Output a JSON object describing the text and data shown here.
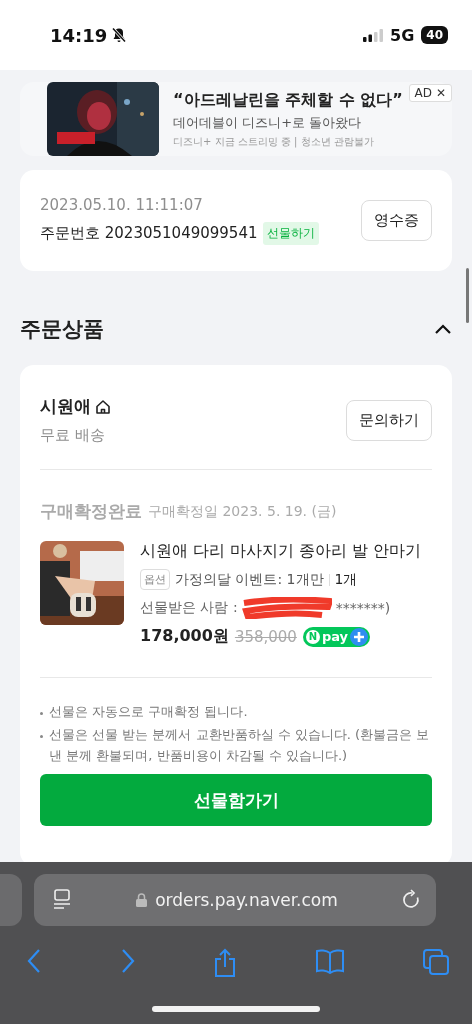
{
  "status_bar": {
    "time": "14:19",
    "network": "5G",
    "battery": "40"
  },
  "ad": {
    "headline": "“아드레날린을 주체할 수 없다”",
    "subline": "데어데블이 디즈니+로 돌아왔다",
    "note": "디즈니+ 지금 스트리밍 중 | 청소년 관람불가",
    "ad_label": "AD",
    "close": "✕"
  },
  "order": {
    "datetime": "2023.05.10. 11:11:07",
    "number_label": "주문번호",
    "number": "2023051049099541",
    "tag": "선물하기",
    "receipt_button": "영수증"
  },
  "section": {
    "title": "주문상품",
    "expanded": true
  },
  "seller": {
    "name": "시원애",
    "shipping": "무료 배송",
    "inquiry_button": "문의하기"
  },
  "item": {
    "status": "구매확정완료",
    "confirm_date": "구매확정일 2023. 5. 19. (금)",
    "title": "시원애 다리 마사지기 종아리 발 안마기",
    "option_tag": "옵션",
    "option": "가정의달 이벤트: 1개만",
    "quantity": "1개",
    "recipient_label": "선물받은 사람 :",
    "recipient_masked_tail": "*******)",
    "price": "178,000원",
    "original_price": "358,000",
    "pay_mark": "N",
    "pay_text": "pay"
  },
  "notes": [
    "선물은 자동으로 구매확정 됩니다.",
    "선물은 선물 받는 분께서 교환반품하실 수 있습니다. (환불금은 보낸 분께 환불되며, 반품비용이 차감될 수 있습니다.)"
  ],
  "gift_box_button": "선물함가기",
  "browser": {
    "url": "orders.pay.naver.com"
  }
}
